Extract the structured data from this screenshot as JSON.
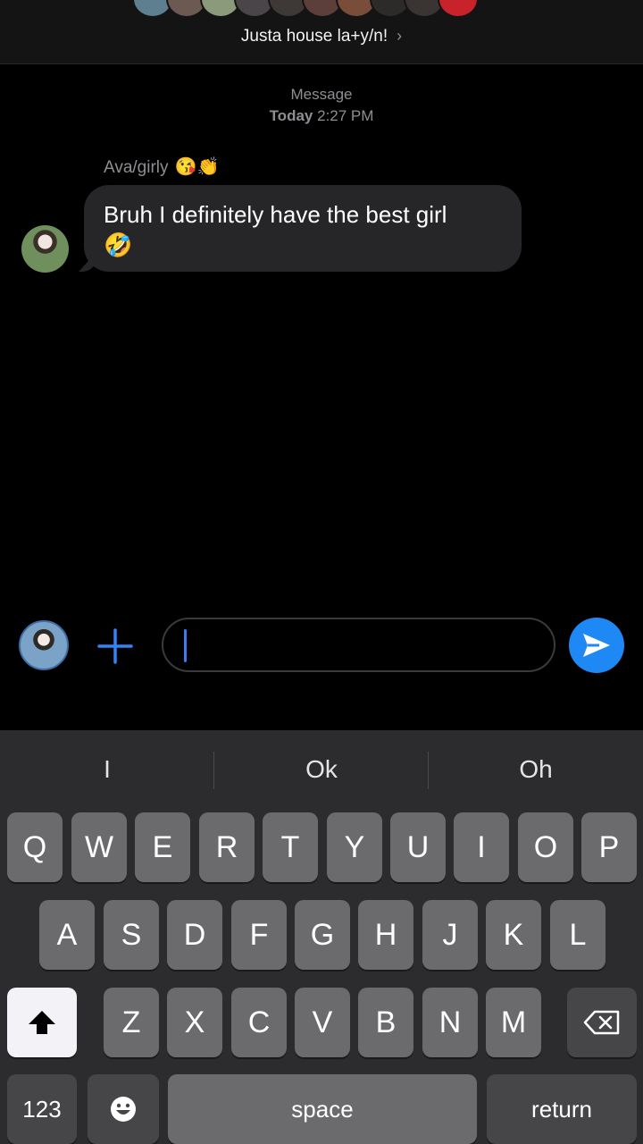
{
  "header": {
    "group_name": "Justa house la+y/n!",
    "chevron": "›"
  },
  "thread": {
    "service": "Message",
    "day": "Today",
    "time": "2:27 PM",
    "sender": "Ava/girly",
    "sender_emoji": "😘👏",
    "message_text": "Bruh I definitely have the best girl",
    "message_emoji": "🤣"
  },
  "composer": {
    "placeholder": ""
  },
  "keyboard": {
    "predictions": [
      "I",
      "Ok",
      "Oh"
    ],
    "row1": [
      "Q",
      "W",
      "E",
      "R",
      "T",
      "Y",
      "U",
      "I",
      "O",
      "P"
    ],
    "row2": [
      "A",
      "S",
      "D",
      "F",
      "G",
      "H",
      "J",
      "K",
      "L"
    ],
    "row3": [
      "Z",
      "X",
      "C",
      "V",
      "B",
      "N",
      "M"
    ],
    "numbers_label": "123",
    "space_label": "space",
    "return_label": "return"
  },
  "colors": {
    "accent": "#1e88f5",
    "bubble": "#262628",
    "keyboard_bg": "#2c2c2e"
  }
}
